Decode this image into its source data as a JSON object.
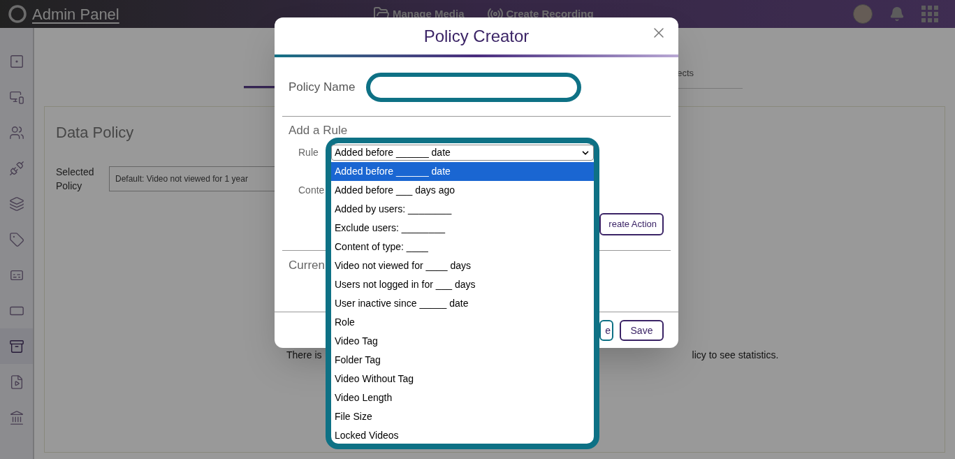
{
  "top_bar": {
    "title": "Admin Panel",
    "nav": [
      {
        "label": "Manage Media",
        "kind": "media"
      },
      {
        "label": "Create Recording",
        "kind": "recording"
      }
    ]
  },
  "sidebar": {
    "items": [
      {
        "kind": "panel",
        "selected": false
      },
      {
        "kind": "devices",
        "selected": false
      },
      {
        "kind": "users",
        "selected": false
      },
      {
        "kind": "plug",
        "selected": false
      },
      {
        "kind": "layers",
        "selected": false
      },
      {
        "kind": "tag",
        "selected": false
      },
      {
        "kind": "captions",
        "selected": false
      },
      {
        "kind": "card",
        "selected": false
      },
      {
        "kind": "archive",
        "selected": true
      },
      {
        "kind": "file-video",
        "selected": false
      },
      {
        "kind": "bank",
        "selected": false
      }
    ]
  },
  "tabs": [
    {
      "label": "ects"
    }
  ],
  "card": {
    "title": "Data Policy",
    "selected_policy_label": "Selected Policy",
    "selected_policy_value": "Default: Video not viewed for 1 year",
    "note_left": "There is",
    "note_right": "licy to see statistics."
  },
  "modal": {
    "title": "Policy Creator",
    "policy_name_label": "Policy Name",
    "add_rule_heading": "Add a Rule",
    "rule_label": "Rule",
    "rule_value": "Added before ______ date",
    "content_label": "Conte",
    "create_action_button": "reate Action",
    "current_heading": "Curren",
    "footer_buttons": [
      {
        "label": "e",
        "kind": "secondary"
      },
      {
        "label": "Save",
        "kind": "primary"
      }
    ]
  },
  "dropdown": {
    "options": [
      {
        "label": "Added before ______ date",
        "selected": true
      },
      {
        "label": "Added before ___ days ago",
        "selected": false
      },
      {
        "label": "Added by users: ________",
        "selected": false
      },
      {
        "label": "Exclude users: ________",
        "selected": false
      },
      {
        "label": "Content of type: ____",
        "selected": false
      },
      {
        "label": "Video not viewed for ____ days",
        "selected": false
      },
      {
        "label": "Users not logged in for ___ days",
        "selected": false
      },
      {
        "label": "User inactive since _____ date",
        "selected": false
      },
      {
        "label": "Role",
        "selected": false
      },
      {
        "label": "Video Tag",
        "selected": false
      },
      {
        "label": "Folder Tag",
        "selected": false
      },
      {
        "label": "Video Without Tag",
        "selected": false
      },
      {
        "label": "Video Length",
        "selected": false
      },
      {
        "label": "File Size",
        "selected": false
      },
      {
        "label": "Locked Videos",
        "selected": false
      }
    ]
  }
}
